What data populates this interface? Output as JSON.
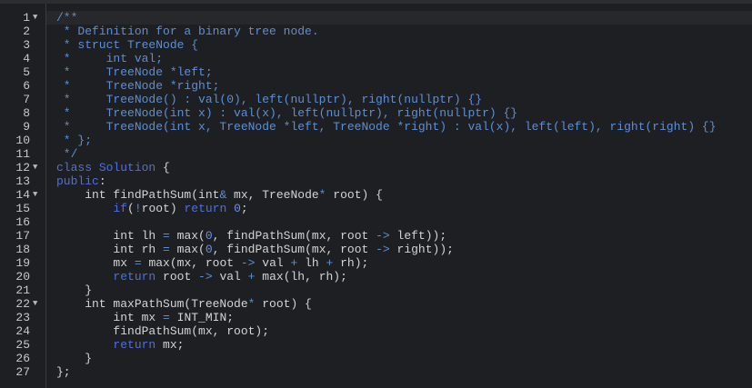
{
  "editor": {
    "lines": [
      {
        "n": "1",
        "fold": "▼",
        "tokens": [
          [
            "c",
            "/**"
          ]
        ]
      },
      {
        "n": "2",
        "fold": "",
        "tokens": [
          [
            "c",
            " * Definition for a binary tree node."
          ]
        ]
      },
      {
        "n": "3",
        "fold": "",
        "tokens": [
          [
            "c",
            " * struct TreeNode {"
          ]
        ]
      },
      {
        "n": "4",
        "fold": "",
        "tokens": [
          [
            "c",
            " *     int val;"
          ]
        ]
      },
      {
        "n": "5",
        "fold": "",
        "tokens": [
          [
            "c",
            " *     TreeNode *left;"
          ]
        ]
      },
      {
        "n": "6",
        "fold": "",
        "tokens": [
          [
            "c",
            " *     TreeNode *right;"
          ]
        ]
      },
      {
        "n": "7",
        "fold": "",
        "tokens": [
          [
            "c",
            " *     TreeNode() : val(0), left(nullptr), right(nullptr) {}"
          ]
        ]
      },
      {
        "n": "8",
        "fold": "",
        "tokens": [
          [
            "c",
            " *     TreeNode(int x) : val(x), left(nullptr), right(nullptr) {}"
          ]
        ]
      },
      {
        "n": "9",
        "fold": "",
        "tokens": [
          [
            "c",
            " *     TreeNode(int x, TreeNode *left, TreeNode *right) : val(x), left(left), right(right) {}"
          ]
        ]
      },
      {
        "n": "10",
        "fold": "",
        "tokens": [
          [
            "c",
            " * };"
          ]
        ]
      },
      {
        "n": "11",
        "fold": "",
        "tokens": [
          [
            "c",
            " */"
          ]
        ]
      },
      {
        "n": "12",
        "fold": "▼",
        "tokens": [
          [
            "k",
            "class"
          ],
          [
            "t",
            " "
          ],
          [
            "k",
            "Solution"
          ],
          [
            "t",
            " {"
          ]
        ]
      },
      {
        "n": "13",
        "fold": "",
        "tokens": [
          [
            "k",
            "public"
          ],
          [
            "t",
            ":"
          ]
        ]
      },
      {
        "n": "14",
        "fold": "▼",
        "tokens": [
          [
            "t",
            "    int findPathSum(int"
          ],
          [
            "o",
            "&"
          ],
          [
            "t",
            " mx, TreeNode"
          ],
          [
            "o",
            "*"
          ],
          [
            "t",
            " root) {"
          ]
        ]
      },
      {
        "n": "15",
        "fold": "",
        "tokens": [
          [
            "t",
            "        "
          ],
          [
            "k",
            "if"
          ],
          [
            "t",
            "("
          ],
          [
            "o",
            "!"
          ],
          [
            "t",
            "root) "
          ],
          [
            "k",
            "return"
          ],
          [
            "t",
            " "
          ],
          [
            "n",
            "0"
          ],
          [
            "t",
            ";"
          ]
        ]
      },
      {
        "n": "16",
        "fold": "",
        "tokens": [
          [
            "t",
            ""
          ]
        ]
      },
      {
        "n": "17",
        "fold": "",
        "tokens": [
          [
            "t",
            "        int lh "
          ],
          [
            "o",
            "="
          ],
          [
            "t",
            " max("
          ],
          [
            "n",
            "0"
          ],
          [
            "t",
            ", findPathSum(mx, root "
          ],
          [
            "o",
            "->"
          ],
          [
            "t",
            " left));"
          ]
        ]
      },
      {
        "n": "18",
        "fold": "",
        "tokens": [
          [
            "t",
            "        int rh "
          ],
          [
            "o",
            "="
          ],
          [
            "t",
            " max("
          ],
          [
            "n",
            "0"
          ],
          [
            "t",
            ", findPathSum(mx, root "
          ],
          [
            "o",
            "->"
          ],
          [
            "t",
            " right));"
          ]
        ]
      },
      {
        "n": "19",
        "fold": "",
        "tokens": [
          [
            "t",
            "        mx "
          ],
          [
            "o",
            "="
          ],
          [
            "t",
            " max(mx, root "
          ],
          [
            "o",
            "->"
          ],
          [
            "t",
            " val "
          ],
          [
            "o",
            "+"
          ],
          [
            "t",
            " lh "
          ],
          [
            "o",
            "+"
          ],
          [
            "t",
            " rh);"
          ]
        ]
      },
      {
        "n": "20",
        "fold": "",
        "tokens": [
          [
            "t",
            "        "
          ],
          [
            "k",
            "return"
          ],
          [
            "t",
            " root "
          ],
          [
            "o",
            "->"
          ],
          [
            "t",
            " val "
          ],
          [
            "o",
            "+"
          ],
          [
            "t",
            " max(lh, rh);"
          ]
        ]
      },
      {
        "n": "21",
        "fold": "",
        "tokens": [
          [
            "t",
            "    }"
          ]
        ]
      },
      {
        "n": "22",
        "fold": "▼",
        "tokens": [
          [
            "t",
            "    int maxPathSum(TreeNode"
          ],
          [
            "o",
            "*"
          ],
          [
            "t",
            " root) {"
          ]
        ]
      },
      {
        "n": "23",
        "fold": "",
        "tokens": [
          [
            "t",
            "        int mx "
          ],
          [
            "o",
            "="
          ],
          [
            "t",
            " INT_MIN;"
          ]
        ]
      },
      {
        "n": "24",
        "fold": "",
        "tokens": [
          [
            "t",
            "        findPathSum(mx, root);"
          ]
        ]
      },
      {
        "n": "25",
        "fold": "",
        "tokens": [
          [
            "t",
            "        "
          ],
          [
            "k",
            "return"
          ],
          [
            "t",
            " mx;"
          ]
        ]
      },
      {
        "n": "26",
        "fold": "",
        "tokens": [
          [
            "t",
            "    }"
          ]
        ]
      },
      {
        "n": "27",
        "fold": "",
        "tokens": [
          [
            "t",
            "};"
          ]
        ]
      }
    ]
  }
}
